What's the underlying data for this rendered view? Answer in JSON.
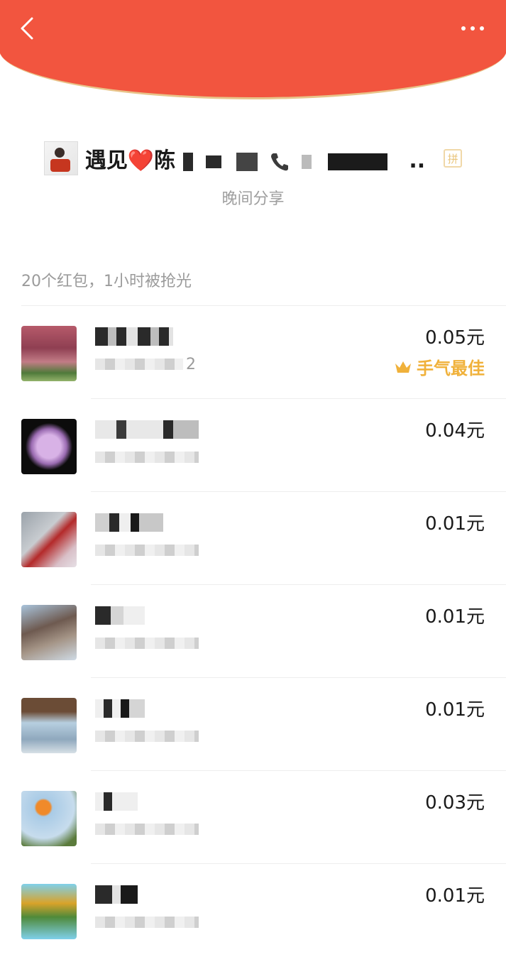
{
  "header": {
    "back_icon": "chevron-left-icon",
    "more_icon": "more-horizontal-icon",
    "background": "#f2553f",
    "rim_color": "#e8c48a"
  },
  "sender": {
    "name_prefix": "遇见❤️陈",
    "name_suffix": "..",
    "pin_badge": "拼",
    "message": "晚间分享"
  },
  "summary": "20个红包，1小时被抢光",
  "recipients": [
    {
      "amount": "0.05元",
      "best_label": "手气最佳",
      "sub_suffix": "2"
    },
    {
      "amount": "0.04元"
    },
    {
      "amount": "0.01元"
    },
    {
      "amount": "0.01元"
    },
    {
      "amount": "0.01元"
    },
    {
      "amount": "0.03元"
    },
    {
      "amount": "0.01元"
    }
  ],
  "colors": {
    "best_label": "#f0b13a",
    "secondary_text": "#9b9b9b"
  }
}
